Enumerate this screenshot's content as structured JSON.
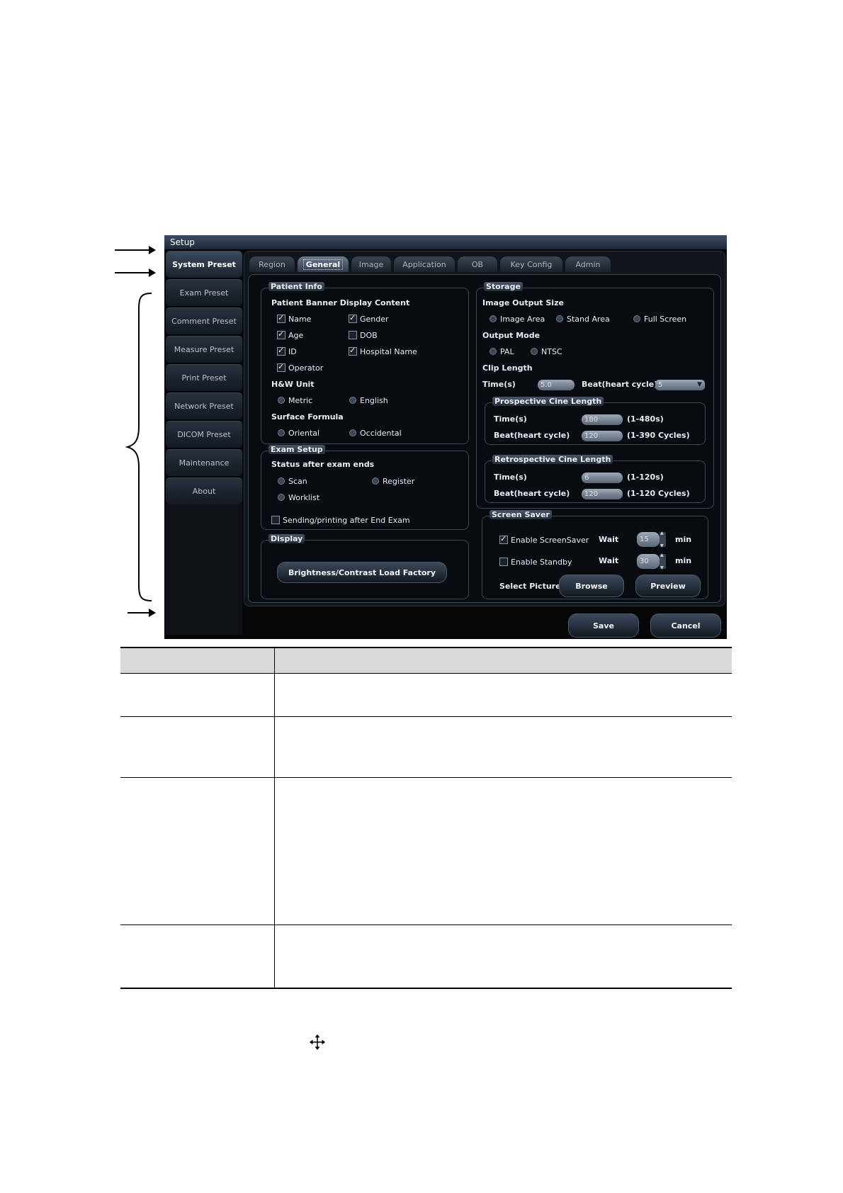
{
  "window": {
    "title": "Setup"
  },
  "sidebar": {
    "items": [
      {
        "label": "System Preset"
      },
      {
        "label": "Exam Preset"
      },
      {
        "label": "Comment Preset"
      },
      {
        "label": "Measure Preset"
      },
      {
        "label": "Print Preset"
      },
      {
        "label": "Network Preset"
      },
      {
        "label": "DICOM Preset"
      },
      {
        "label": "Maintenance"
      },
      {
        "label": "About"
      }
    ]
  },
  "tabs": [
    {
      "label": "Region"
    },
    {
      "label": "General"
    },
    {
      "label": "Image"
    },
    {
      "label": "Application"
    },
    {
      "label": "OB"
    },
    {
      "label": "Key Config"
    },
    {
      "label": "Admin"
    }
  ],
  "patient_info": {
    "title": "Patient Info",
    "banner_heading": "Patient Banner Display Content",
    "name": "Name",
    "gender": "Gender",
    "age": "Age",
    "dob": "DOB",
    "id": "ID",
    "hospital_name": "Hospital Name",
    "operator": "Operator",
    "hw_unit": "H&W Unit",
    "metric": "Metric",
    "english": "English",
    "surface_formula": "Surface Formula",
    "oriental": "Oriental",
    "occidental": "Occidental"
  },
  "exam_setup": {
    "title": "Exam Setup",
    "status_heading": "Status after exam ends",
    "scan": "Scan",
    "register": "Register",
    "worklist": "Worklist",
    "sending": "Sending/printing after End Exam"
  },
  "display": {
    "title": "Display",
    "button": "Brightness/Contrast Load Factory"
  },
  "storage": {
    "title": "Storage",
    "image_output_size": "Image Output Size",
    "image_area": "Image Area",
    "stand_area": "Stand Area",
    "full_screen": "Full Screen",
    "output_mode": "Output Mode",
    "pal": "PAL",
    "ntsc": "NTSC",
    "clip_length": "Clip Length",
    "time_label": "Time(s)",
    "time_value": "5.0",
    "beat_label": "Beat(heart cycle)",
    "beat_value": "5"
  },
  "prospective": {
    "title": "Prospective Cine Length",
    "time_label": "Time(s)",
    "time_value": "180",
    "time_range": "(1-480s)",
    "beat_label": "Beat(heart cycle)",
    "beat_value": "120",
    "beat_range": "(1-390 Cycles)"
  },
  "retrospective": {
    "title": "Retrospective Cine Length",
    "time_label": "Time(s)",
    "time_value": "6",
    "time_range": "(1-120s)",
    "beat_label": "Beat(heart cycle)",
    "beat_value": "120",
    "beat_range": "(1-120 Cycles)"
  },
  "screen_saver": {
    "title": "Screen Saver",
    "enable_screensaver": "Enable ScreenSaver",
    "wait1": "Wait",
    "wait1_value": "15",
    "min1": "min",
    "enable_standby": "Enable Standby",
    "wait2": "Wait",
    "wait2_value": "30",
    "min2": "min",
    "select_picture": "Select Picture",
    "browse": "Browse",
    "preview": "Preview"
  },
  "footer": {
    "save": "Save",
    "cancel": "Cancel"
  },
  "icons": {
    "move": "move-icon"
  }
}
